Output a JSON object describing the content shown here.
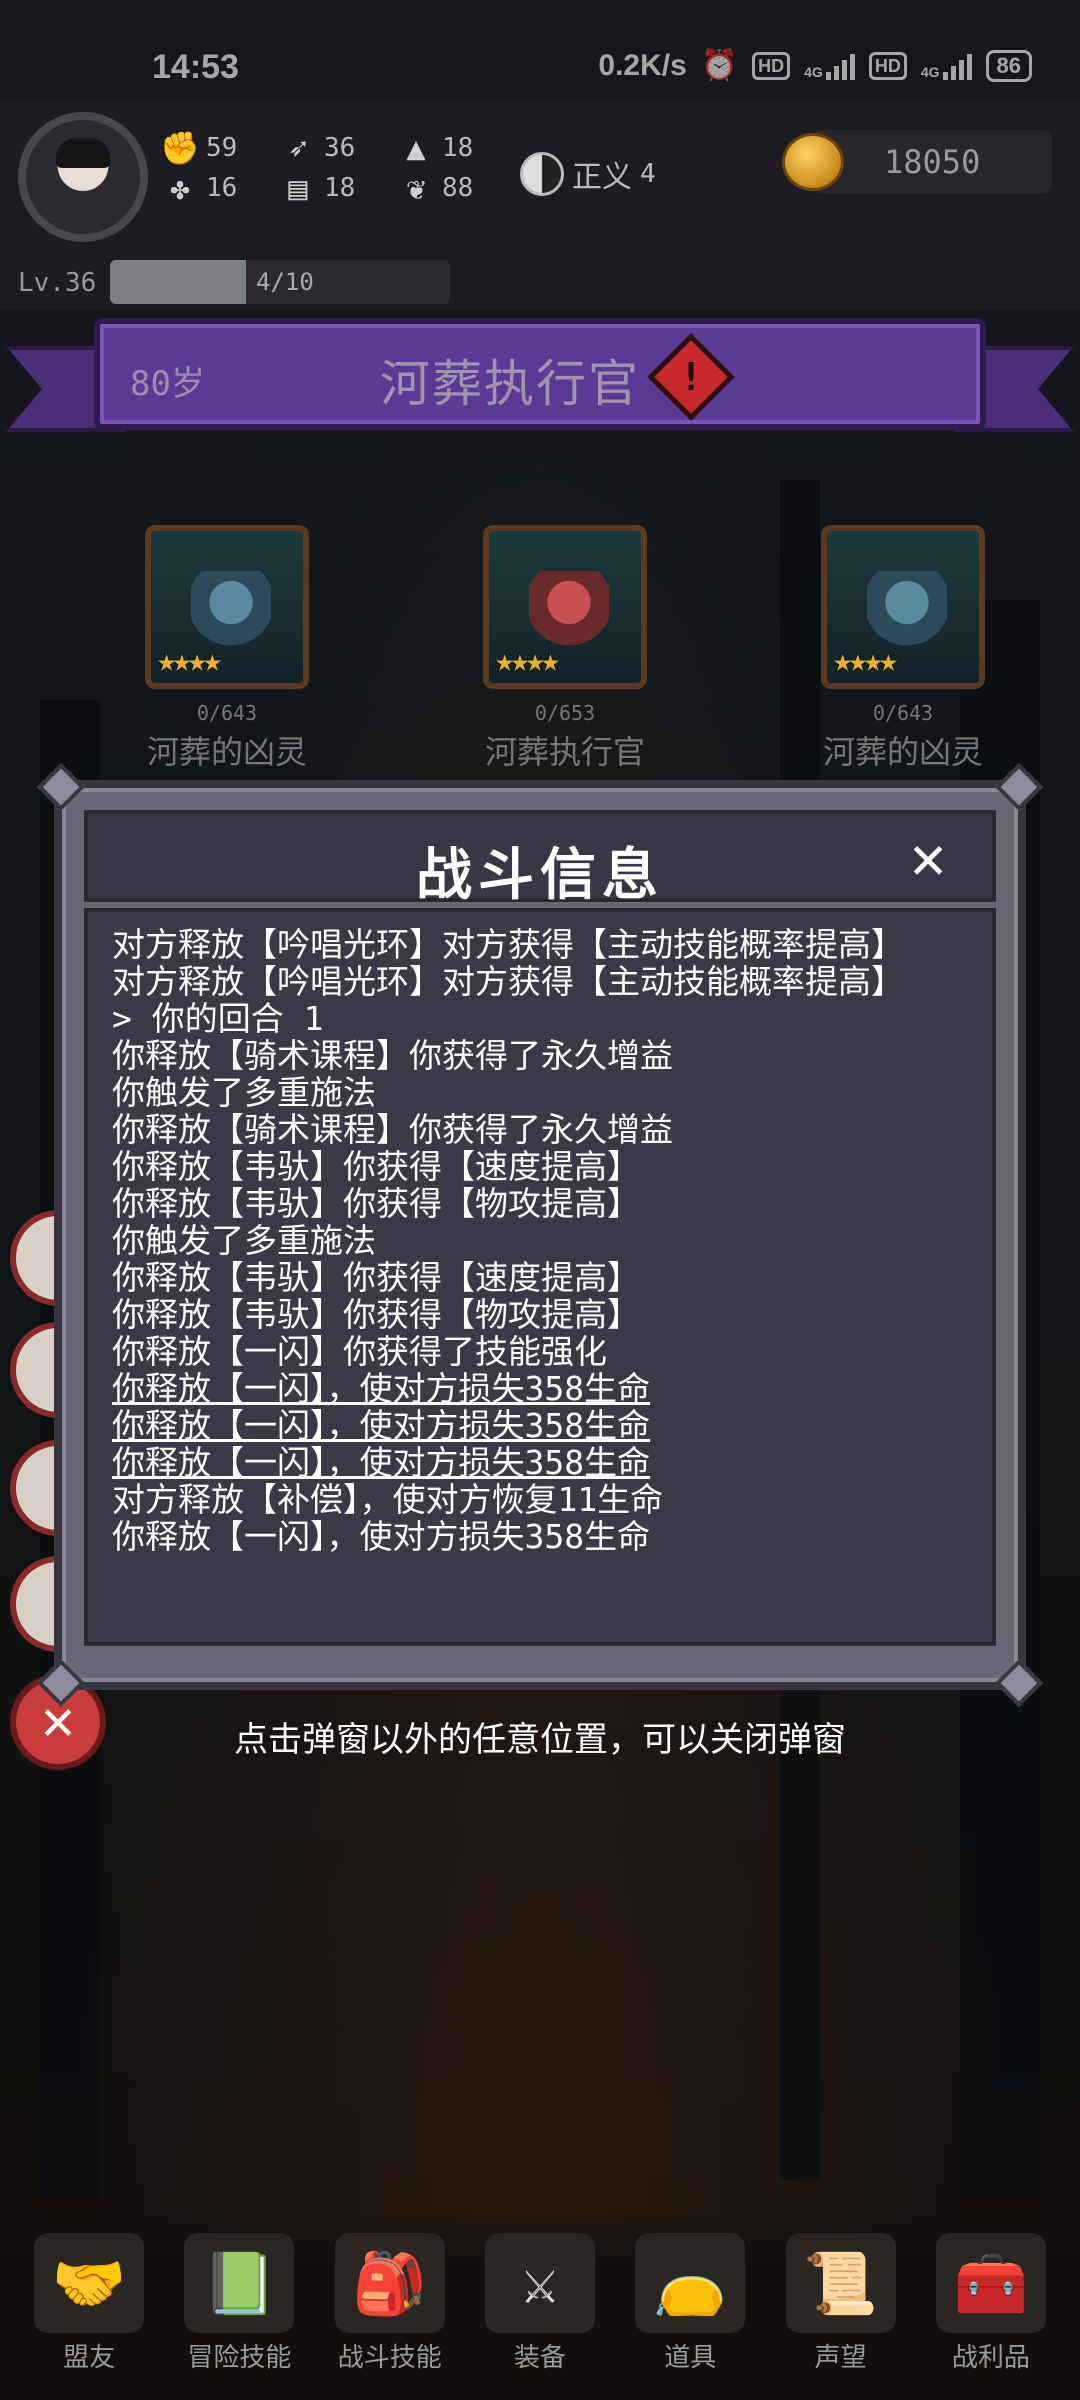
{
  "status_bar": {
    "time": "14:53",
    "network_speed": "0.2K/s",
    "hd1": "HD",
    "net1": "4G",
    "hd2": "HD",
    "net2": "4G",
    "battery": "86"
  },
  "player": {
    "level": "Lv.36",
    "xp_text": "4/10",
    "xp_fraction": 0.4,
    "stats": [
      {
        "icon": "fist-icon",
        "value": "59"
      },
      {
        "icon": "arrow-icon",
        "value": "36"
      },
      {
        "icon": "wizard-hat-icon",
        "value": "18"
      },
      {
        "icon": "clover-icon",
        "value": "16"
      },
      {
        "icon": "book-icon",
        "value": "18"
      },
      {
        "icon": "leaf-icon",
        "value": "88"
      }
    ],
    "alignment_label": "正义",
    "alignment_value": "4",
    "gold": "18050"
  },
  "banner": {
    "age": "80岁",
    "title": "河葬执行官",
    "warning_glyph": "!"
  },
  "enemies": [
    {
      "hp": "0/643",
      "name": "河葬的凶灵",
      "stars": "★★★★"
    },
    {
      "hp": "0/653",
      "name": "河葬执行官",
      "stars": "★★★★"
    },
    {
      "hp": "0/643",
      "name": "河葬的凶灵",
      "stars": "★★★★"
    }
  ],
  "modal": {
    "title": "战斗信息",
    "close_glyph": "✕",
    "log": [
      "对方释放【吟唱光环】对方获得【主动技能概率提高】",
      "对方释放【吟唱光环】对方获得【主动技能概率提高】",
      "> 你的回合 1",
      "你释放【骑术课程】你获得了永久增益",
      "你触发了多重施法",
      "你释放【骑术课程】你获得了永久增益",
      "你释放【韦驮】你获得【速度提高】",
      "你释放【韦驮】你获得【物攻提高】",
      "你触发了多重施法",
      "你释放【韦驮】你获得【速度提高】",
      "你释放【韦驮】你获得【物攻提高】",
      "你释放【一闪】你获得了技能强化",
      "你释放【一闪】，使对方损失358生命",
      "你释放【一闪】，使对方损失358生命",
      "你释放【一闪】，使对方损失358生命",
      "对方释放【补偿】，使对方恢复11生命",
      "你释放【一闪】，使对方损失358生命"
    ]
  },
  "hint": "点击弹窗以外的任意位置，可以关闭弹窗",
  "nav": [
    {
      "label": "盟友",
      "icon": "handshake-icon"
    },
    {
      "label": "冒险技能",
      "icon": "spellbook-icon"
    },
    {
      "label": "战斗技能",
      "icon": "backpack-icon"
    },
    {
      "label": "装备",
      "icon": "crossed-swords-icon"
    },
    {
      "label": "道具",
      "icon": "pouch-icon"
    },
    {
      "label": "声望",
      "icon": "scroll-icon"
    },
    {
      "label": "战利品",
      "icon": "treasure-chest-icon"
    }
  ],
  "colors": {
    "banner_purple": "#5b3a96",
    "modal_frame": "#6b6676",
    "modal_body": "#3b3848",
    "star_gold": "#e8b030",
    "warning_red": "#c8282a"
  }
}
